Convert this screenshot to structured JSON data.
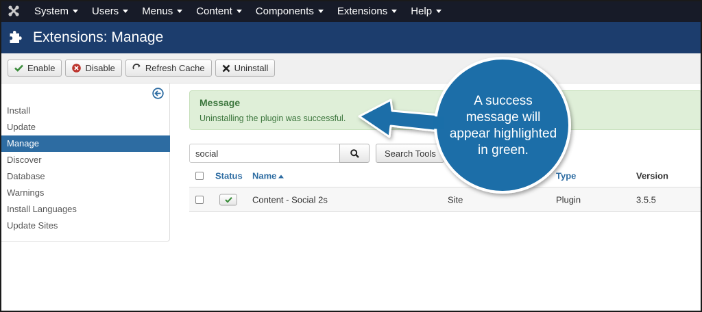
{
  "nav": {
    "items": [
      {
        "label": "System"
      },
      {
        "label": "Users"
      },
      {
        "label": "Menus"
      },
      {
        "label": "Content"
      },
      {
        "label": "Components"
      },
      {
        "label": "Extensions"
      },
      {
        "label": "Help"
      }
    ]
  },
  "title": "Extensions: Manage",
  "toolbar": {
    "enable": "Enable",
    "disable": "Disable",
    "refresh": "Refresh Cache",
    "uninstall": "Uninstall"
  },
  "sidebar": {
    "items": [
      {
        "label": "Install"
      },
      {
        "label": "Update"
      },
      {
        "label": "Manage",
        "active": true
      },
      {
        "label": "Discover"
      },
      {
        "label": "Database"
      },
      {
        "label": "Warnings"
      },
      {
        "label": "Install Languages"
      },
      {
        "label": "Update Sites"
      }
    ]
  },
  "message": {
    "title": "Message",
    "text": "Uninstalling the plugin was successful."
  },
  "search": {
    "value": "social",
    "tools_label": "Search Tools"
  },
  "table": {
    "headers": {
      "status": "Status",
      "name": "Name",
      "type": "Type",
      "version": "Version"
    },
    "rows": [
      {
        "name": "Content - Social 2s",
        "location": "Site",
        "type": "Plugin",
        "version": "3.5.5"
      }
    ]
  },
  "callout": {
    "line1": "A success",
    "line2": "message will",
    "line3": "appear highlighted",
    "line4": "in green."
  },
  "colors": {
    "nav_bg": "#171b28",
    "title_bg": "#1c3d6d",
    "active": "#2d6ca2",
    "message_bg": "#dfefd8",
    "message_text": "#3c763d",
    "callout": "#1a6ea8"
  }
}
